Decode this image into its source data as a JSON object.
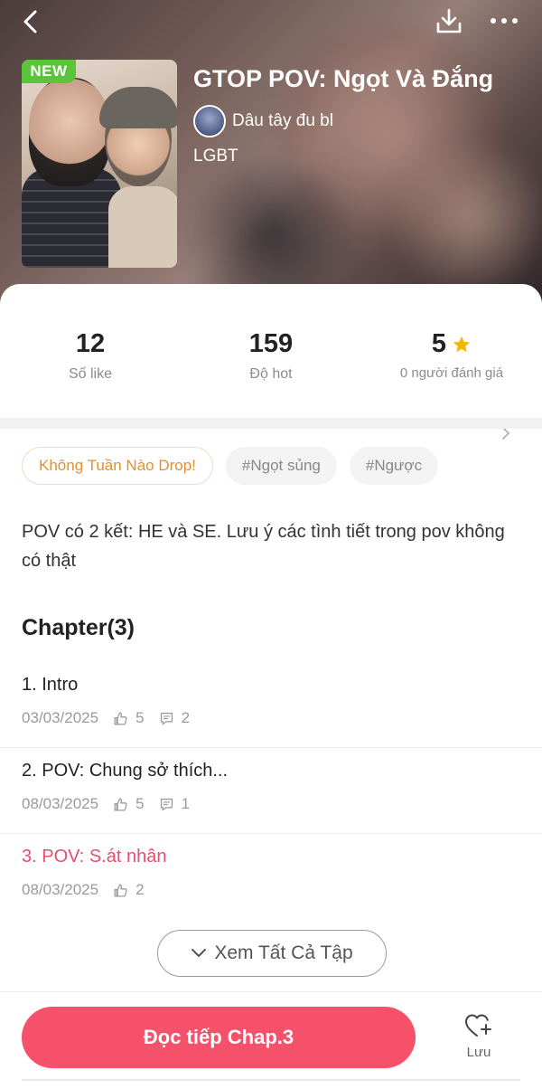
{
  "story": {
    "title": "GTOP POV: Ngọt Và Đắng",
    "author": "Dâu tây đu bl",
    "genre": "LGBT",
    "badge": "NEW",
    "description": "POV có 2 kết: HE và SE. Lưu ý các tình tiết trong pov không có thật"
  },
  "stats": {
    "likes_value": "12",
    "likes_label": "Số like",
    "hot_value": "159",
    "hot_label": "Độ hot",
    "rating_value": "5",
    "rating_label": "0 người đánh giá"
  },
  "tags": [
    "Không Tuần Nào Drop!",
    "#Ngọt sủng",
    "#Ngược"
  ],
  "chapters_heading": "Chapter(3)",
  "chapters": [
    {
      "title": "1. Intro",
      "date": "03/03/2025",
      "likes": "5",
      "comments": "2"
    },
    {
      "title": "2. POV: Chung sở thích...",
      "date": "08/03/2025",
      "likes": "5",
      "comments": "1"
    },
    {
      "title": "3. POV: S.át nhân",
      "date": "08/03/2025",
      "likes": "2"
    }
  ],
  "see_all_label": "Xem Tất Cả Tập",
  "read_button_label": "Đọc tiếp Chap.3",
  "save_label": "Lưu",
  "icons": {
    "back": "chevron-left-icon",
    "download": "download-icon",
    "more": "more-dots-icon",
    "star": "star-icon",
    "like": "thumbs-up-icon",
    "comment": "comment-icon",
    "save": "heart-plus-icon"
  },
  "colors": {
    "accent": "#f5516b",
    "current_chapter": "#e84d6d",
    "star": "#f7b500",
    "new_badge": "#5cc43a",
    "highlight_tag": "#e0912e"
  }
}
